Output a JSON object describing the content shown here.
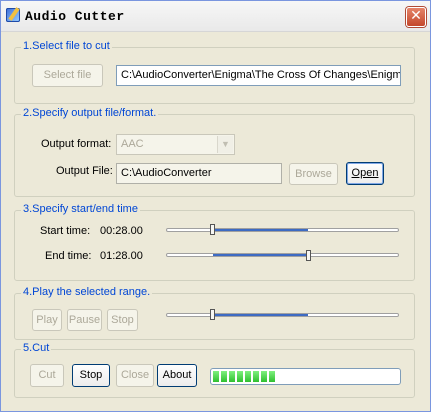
{
  "window": {
    "title": "Audio Cutter",
    "icon": "scissors-app-icon",
    "close_glyph": "✕"
  },
  "section1": {
    "title": "1.Select file to cut",
    "select_button": "Select file",
    "file_path": "C:\\AudioConverter\\Enigma\\The Cross Of Changes\\Enigma"
  },
  "section2": {
    "title": "2.Specify output file/format.",
    "format_label": "Output format:",
    "format_value": "AAC",
    "file_label": "Output File:",
    "file_value": "C:\\AudioConverter",
    "browse_button": "Browse",
    "open_button": "Open"
  },
  "section3": {
    "title": "3.Specify start/end time",
    "start_label": "Start time:",
    "start_value": "00:28.00",
    "end_label": "End time:",
    "end_value": "01:28.00"
  },
  "section4": {
    "title": "4.Play the selected range.",
    "play_button": "Play",
    "pause_button": "Pause",
    "stop_button": "Stop"
  },
  "section5": {
    "title": "5.Cut",
    "cut_button": "Cut",
    "stop_button": "Stop",
    "close_button": "Close",
    "about_button": "About",
    "progress_fraction": 0.35
  },
  "colors": {
    "group_title": "#0046d5",
    "slider_fill": "#3d6bc3",
    "progress_chunk": "#3ccf3c"
  }
}
